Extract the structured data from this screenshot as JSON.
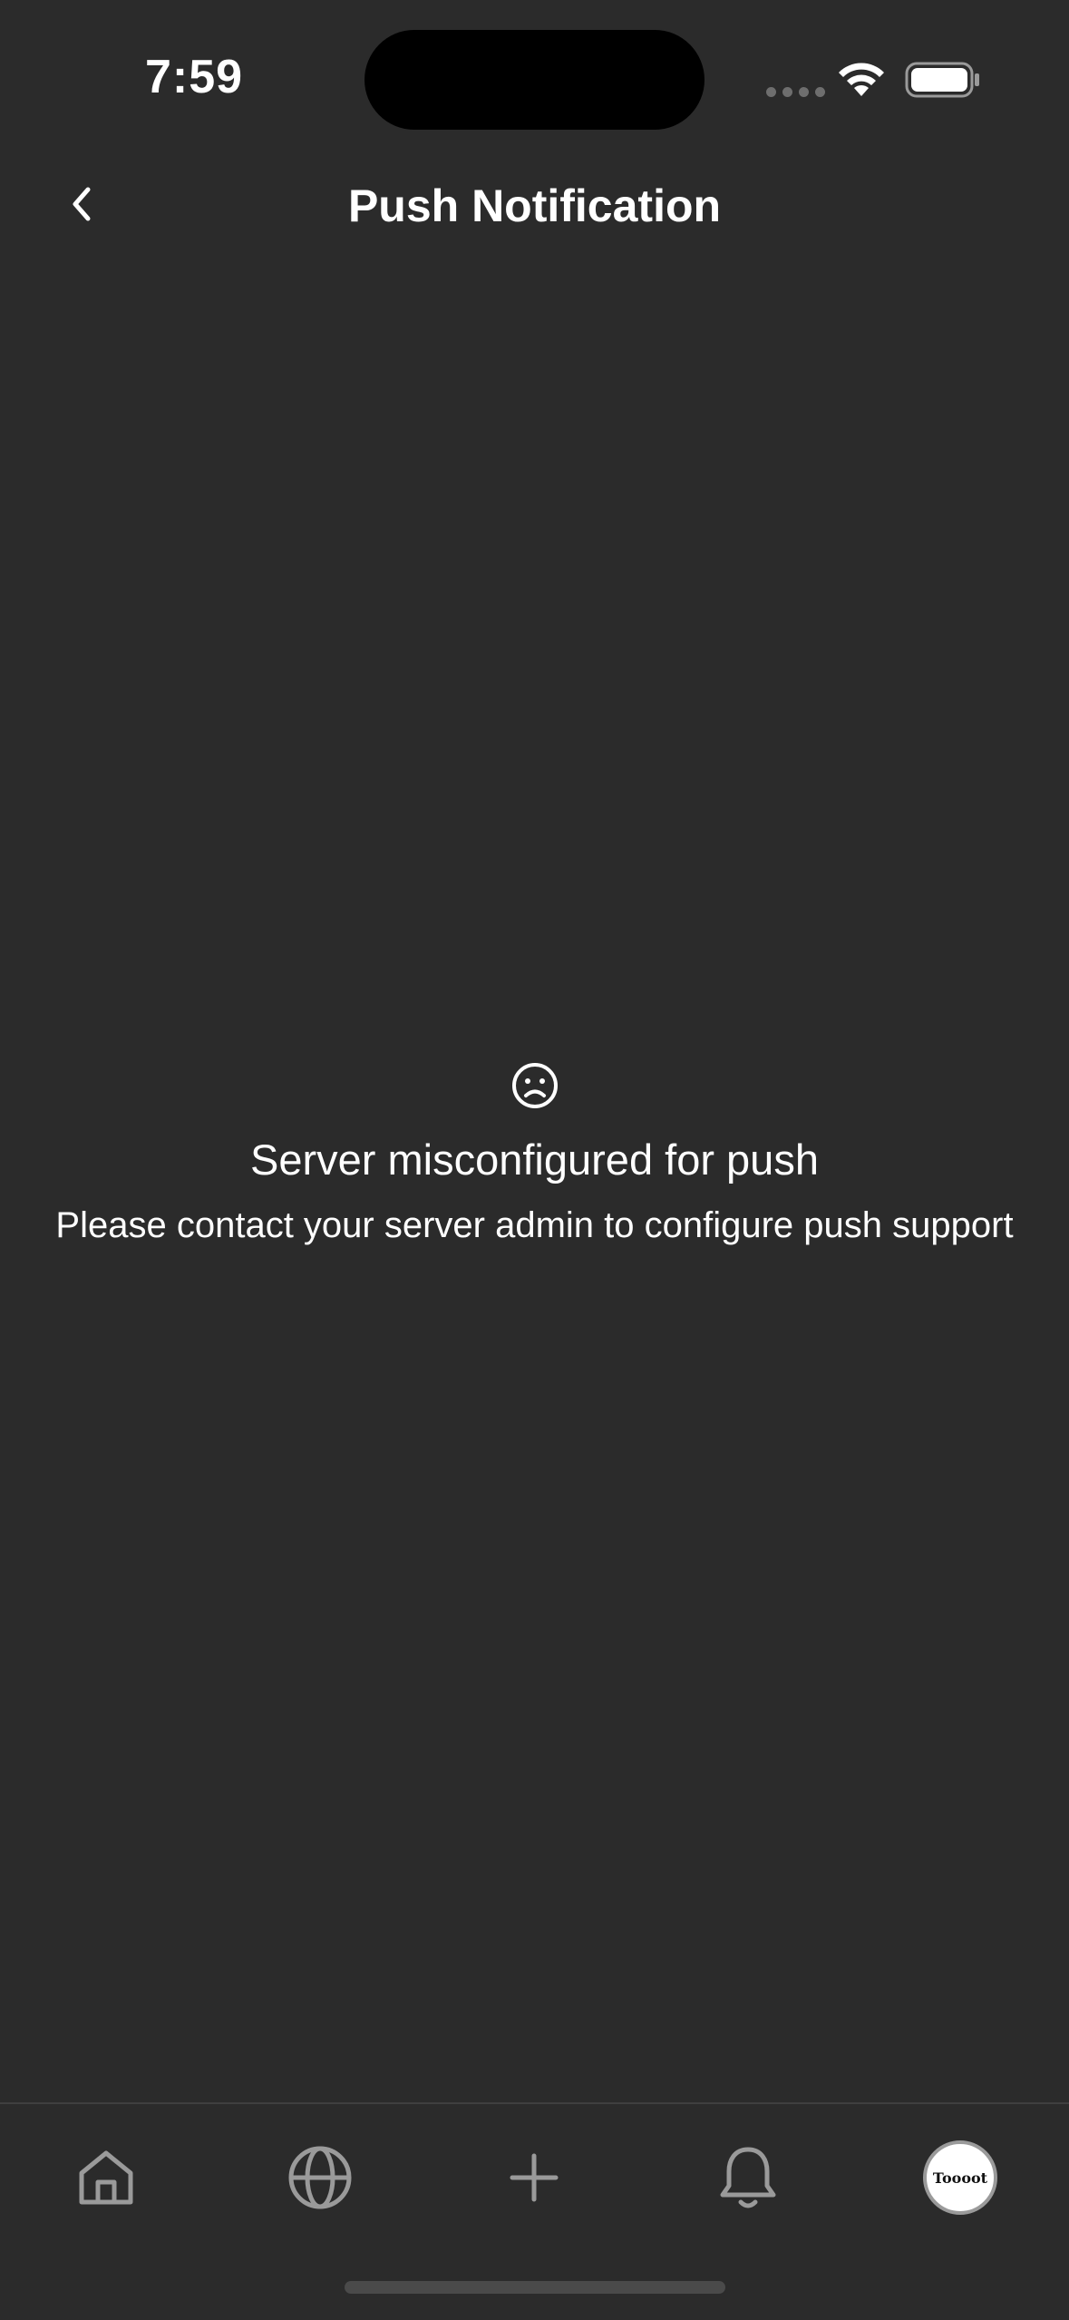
{
  "status_bar": {
    "time": "7:59",
    "icons": [
      "cellular-dots-icon",
      "wifi-icon",
      "battery-icon"
    ]
  },
  "nav": {
    "title": "Push Notification",
    "back_icon": "chevron-left-icon"
  },
  "empty_state": {
    "icon": "sad-face-icon",
    "title": "Server misconfigured for push",
    "description": "Please contact your server admin to configure push support"
  },
  "tab_bar": {
    "tabs": [
      {
        "icon": "home-icon"
      },
      {
        "icon": "globe-icon"
      },
      {
        "icon": "plus-icon"
      },
      {
        "icon": "bell-icon"
      },
      {
        "icon": "profile-avatar",
        "avatar_text": "Toooot"
      }
    ]
  },
  "colors": {
    "background": "#2b2b2b",
    "text": "#ffffff",
    "tab_icon": "#9a9a9a",
    "divider": "#3f3f3f"
  }
}
